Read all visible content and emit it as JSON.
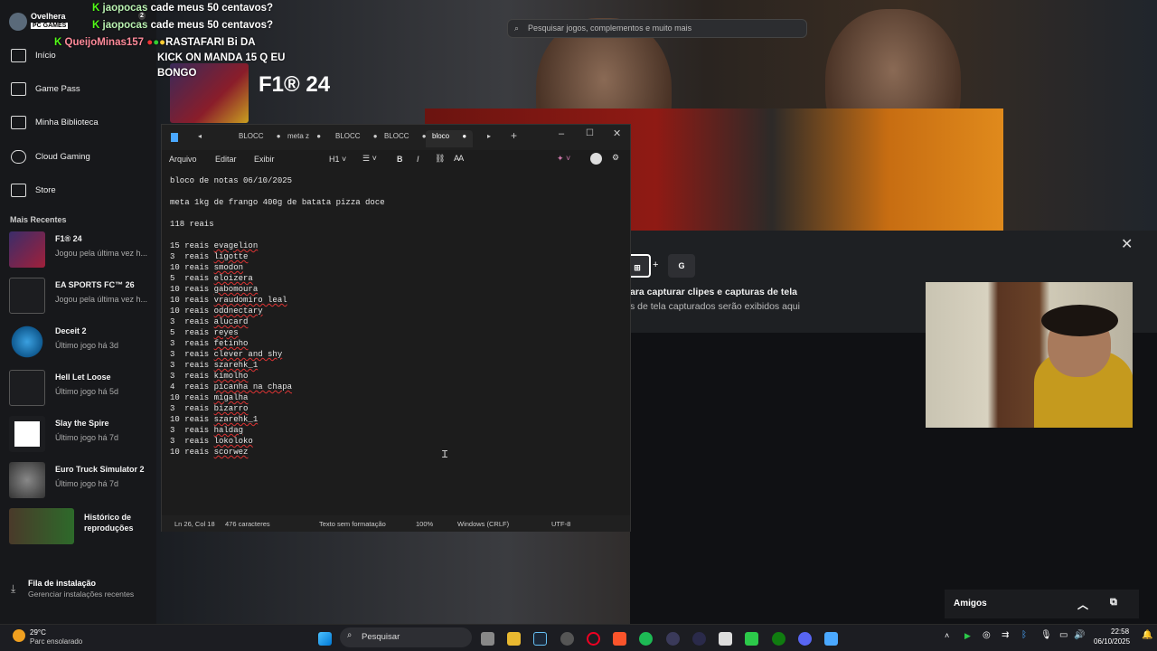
{
  "profile": {
    "name": "Ovelhera",
    "tag": "PC GAMES"
  },
  "nav": [
    {
      "label": "Início",
      "icon": "home-icon"
    },
    {
      "label": "Game Pass",
      "icon": "gamepass-icon"
    },
    {
      "label": "Minha Biblioteca",
      "icon": "library-icon"
    },
    {
      "label": "Cloud Gaming",
      "icon": "cloud-icon"
    },
    {
      "label": "Store",
      "icon": "store-icon"
    }
  ],
  "recent_header": "Mais Recentes",
  "recent": [
    {
      "title": "F1® 24",
      "sub": "Jogou pela última vez h..."
    },
    {
      "title": "EA SPORTS FC™ 26",
      "sub": "Jogou pela última vez h..."
    },
    {
      "title": "Deceit 2",
      "sub": "Último jogo há 3d"
    },
    {
      "title": "Hell Let Loose",
      "sub": "Último jogo há 5d"
    },
    {
      "title": "Slay the Spire",
      "sub": "Último jogo há 7d"
    },
    {
      "title": "Euro Truck Simulator 2",
      "sub": "Último jogo há 7d"
    },
    {
      "title": "Histórico de reproduções",
      "sub": ""
    }
  ],
  "install": {
    "title": "Fila de instalação",
    "sub": "Gerenciar instalações recentes"
  },
  "chat": [
    {
      "user": "jaopocas",
      "msg": "cade meus 50 centavos?"
    },
    {
      "user": "jaopocas",
      "msg": "cade meus 50 centavos?"
    },
    {
      "user": "QueijoMinas157",
      "msg": "RASTAFARI Bi DA"
    },
    {
      "user": "",
      "msg": "KICK ON MANDA 15 Q EU"
    },
    {
      "user": "",
      "msg": "BONGO"
    }
  ],
  "badge_count": "2",
  "search": {
    "placeholder": "Pesquisar jogos, complementos e muito mais"
  },
  "game": {
    "title": "F1® 24"
  },
  "notepad": {
    "tabs": [
      "BLOCC",
      "meta z",
      "BLOCC",
      "BLOCC",
      "bloco"
    ],
    "menu": [
      "Arquivo",
      "Editar",
      "Exibir"
    ],
    "heading": "H1",
    "lines": [
      "bloco de notas 06/10/2025",
      "",
      "meta 1kg de frango 400g de batata pizza doce",
      "",
      "118 reais",
      "",
      "15 reais evagelion",
      "3  reais ligotte",
      "10 reais smodon",
      "5  reais eloizera",
      "10 reais gabomoura",
      "10 reais vraudomiro leal",
      "10 reais oddnectary",
      "3  reais alucard",
      "5  reais reyes",
      "3  reais fetinho",
      "3  reais clever and shy",
      "3  reais szarehk_1",
      "3  reais kimolho",
      "4  reais picanha na chapa",
      "10 reais migalha",
      "3  reais bizarro",
      "10 reais szarehk_1",
      "3  reais haldag",
      "3  reais lokoloko",
      "10 reais scorwez"
    ],
    "status": {
      "pos": "Ln 26, Col 18",
      "chars": "476 caracteres",
      "format": "Texto sem formatação",
      "zoom": "100%",
      "eol": "Windows (CRLF)",
      "enc": "UTF-8"
    }
  },
  "capture": {
    "title": "ara capturar clipes e capturas de tela",
    "sub": "s de tela capturados serão exibidos aqui",
    "key_plus": "+",
    "key_g": "G"
  },
  "friends": {
    "label": "Amigos"
  },
  "taskbar": {
    "weather_temp": "29°C",
    "weather_desc": "Parc ensolarado",
    "search": "Pesquisar",
    "time": "22:58",
    "date": "06/10/2025"
  }
}
